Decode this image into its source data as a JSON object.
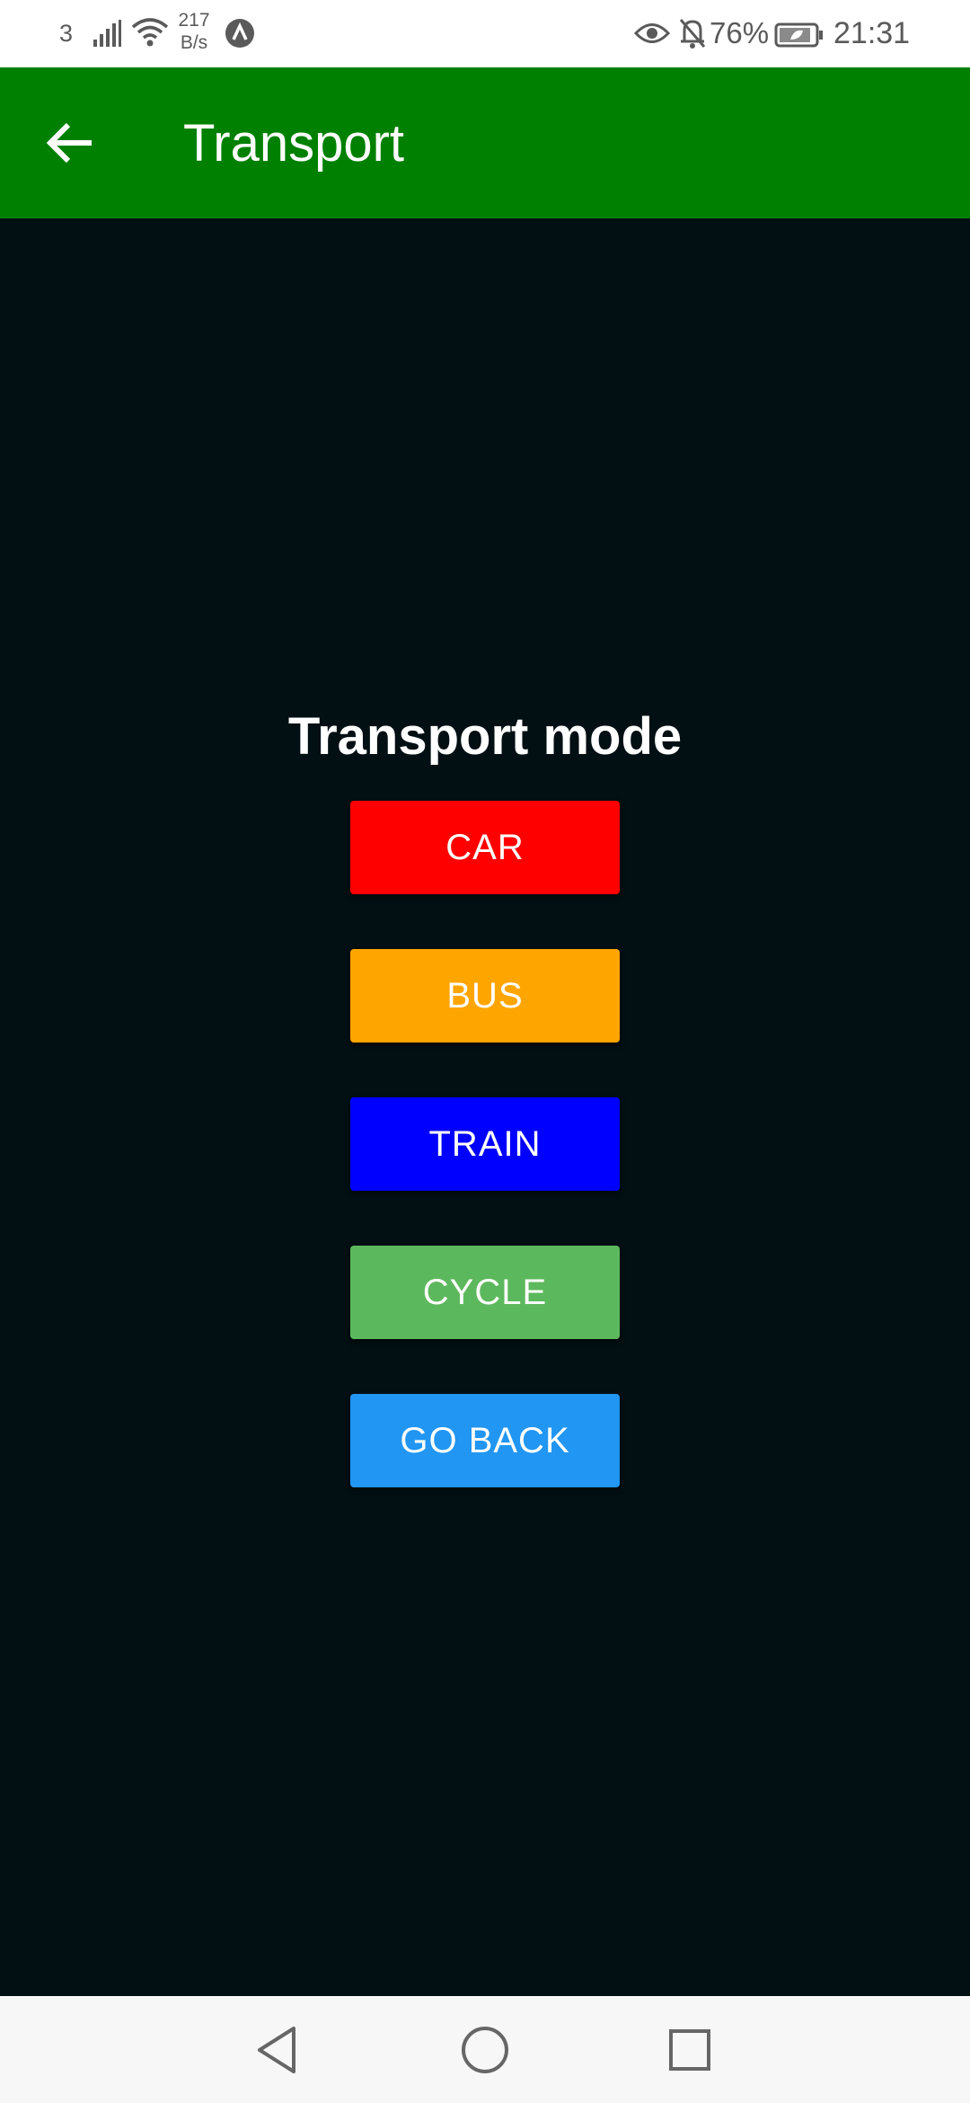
{
  "status_bar": {
    "sim": "3",
    "speed_value": "217",
    "speed_unit": "B/s",
    "battery_percent": "76%",
    "time": "21:31",
    "icons": [
      "signal-icon",
      "wifi-icon",
      "app-notification-icon",
      "eye-icon",
      "bell-off-icon",
      "battery-saver-icon"
    ]
  },
  "app_bar": {
    "title": "Transport",
    "back_icon": "arrow-left-icon",
    "background_color": "#008000"
  },
  "content": {
    "heading": "Transport mode",
    "background_color": "#020f13",
    "buttons": [
      {
        "label": "CAR",
        "color": "#ff0000"
      },
      {
        "label": "BUS",
        "color": "#ffa500"
      },
      {
        "label": "TRAIN",
        "color": "#0000ff"
      },
      {
        "label": "CYCLE",
        "color": "#5cb85c"
      },
      {
        "label": "GO BACK",
        "color": "#2196f3"
      }
    ]
  },
  "nav_bar": {
    "icons": [
      "nav-back-icon",
      "nav-home-icon",
      "nav-recents-icon"
    ]
  }
}
